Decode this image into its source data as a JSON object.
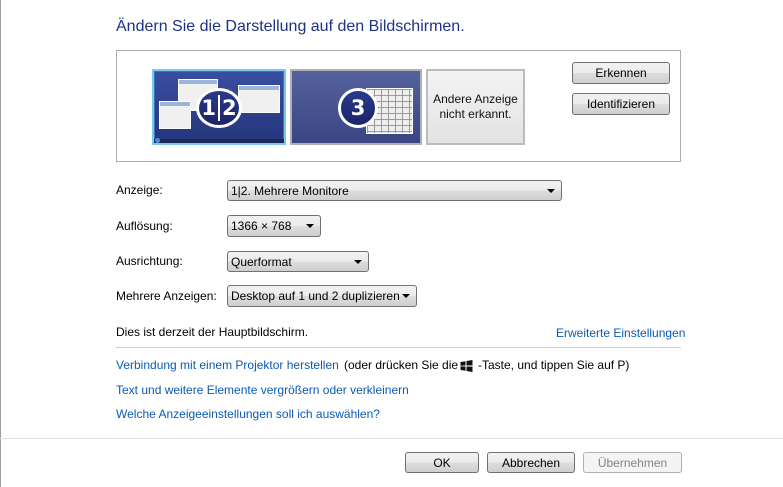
{
  "title": "Ändern Sie die Darstellung auf den Bildschirmen.",
  "monitors": {
    "primary_badge_left": "1",
    "primary_badge_right": "2",
    "secondary_badge": "3",
    "other_label": "Andere Anzeige nicht erkannt."
  },
  "side_buttons": {
    "detect": "Erkennen",
    "identify": "Identifizieren"
  },
  "settings": {
    "display": {
      "label": "Anzeige:",
      "value": "1|2. Mehrere Monitore"
    },
    "resolution": {
      "label": "Auflösung:",
      "value": "1366 × 768"
    },
    "orientation": {
      "label": "Ausrichtung:",
      "value": "Querformat"
    },
    "multiple": {
      "label": "Mehrere Anzeigen:",
      "value": "Desktop auf 1 und 2 duplizieren"
    }
  },
  "status": {
    "main_display_text": "Dies ist derzeit der Hauptbildschirm.",
    "advanced_link": "Erweiterte Einstellungen"
  },
  "links": {
    "projector": "Verbindung mit einem Projektor herstellen",
    "projector_hint_pre": "(oder drücken Sie die",
    "projector_hint_post": "-Taste, und tippen Sie auf P)",
    "text_size": "Text und weitere Elemente vergrößern oder verkleinern",
    "which_settings": "Welche Anzeigeeinstellungen soll ich auswählen?"
  },
  "footer": {
    "ok": "OK",
    "cancel": "Abbrechen",
    "apply": "Übernehmen"
  },
  "colors": {
    "title": "#1e3287",
    "link": "#0a5ab4",
    "selected_monitor_border": "#7cc8ee"
  }
}
